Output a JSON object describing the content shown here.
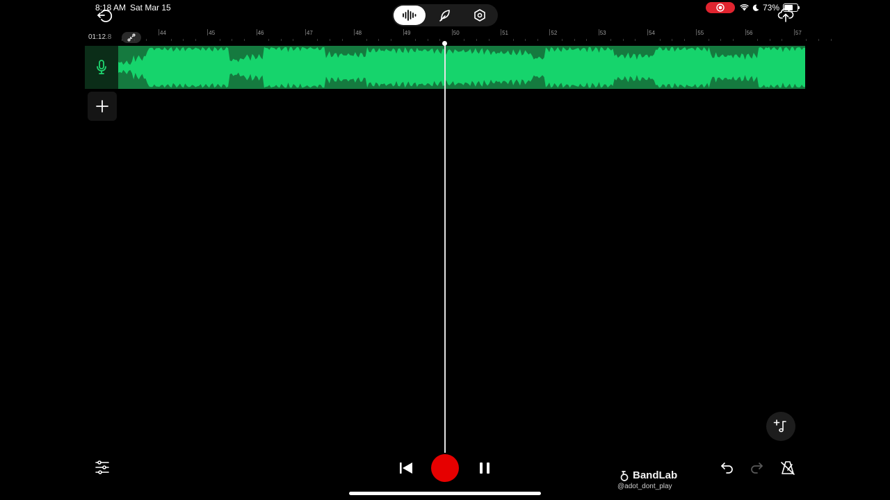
{
  "status_bar": {
    "time": "8:18 AM",
    "date": "Sat Mar 15",
    "battery": "73%",
    "battery_level": 0.73,
    "icons": [
      "screen-record-icon",
      "wifi-icon",
      "moon-icon",
      "battery-icon"
    ]
  },
  "mode_switch": {
    "active": "waveform-icon",
    "items": [
      "waveform-icon",
      "feather-icon",
      "hexagon-settings-icon"
    ]
  },
  "timeline": {
    "position": "01:12",
    "position_fraction": ".8",
    "bars": [
      "44",
      "45",
      "46",
      "47",
      "48",
      "49",
      "50",
      "51",
      "52",
      "53",
      "54",
      "55",
      "56",
      "57"
    ]
  },
  "track": {
    "icon": "microphone-icon"
  },
  "brand": {
    "name": "BandLab",
    "handle": "@adot_dont_play"
  },
  "colors": {
    "background": "#000000",
    "region": "#157a3f",
    "waveform": "#16d46c",
    "track_header": "#0b2d18",
    "record": "#e60000",
    "recording_badge": "#e0242f"
  }
}
